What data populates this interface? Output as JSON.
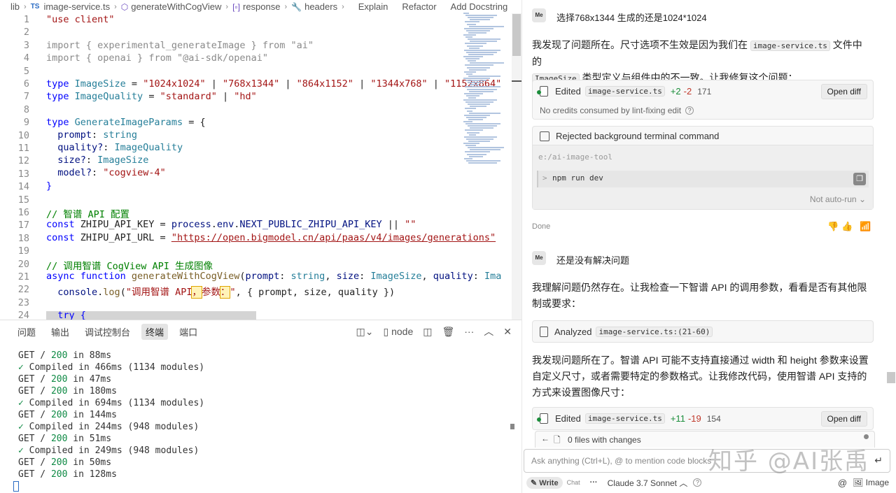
{
  "breadcrumb": {
    "folder": "lib",
    "ts_badge": "TS",
    "file": "image-service.ts",
    "symbol": "generateWithCogView",
    "var": "response",
    "field": "headers",
    "actions": [
      "Explain",
      "Refactor",
      "Add Docstring"
    ]
  },
  "line_numbers": [
    "1",
    "2",
    "3",
    "4",
    "5",
    "6",
    "7",
    "8",
    "9",
    "10",
    "11",
    "12",
    "13",
    "14",
    "15",
    "16",
    "17",
    "18",
    "19",
    "20",
    "21",
    "22",
    "23",
    "24"
  ],
  "code": {
    "l1": "\"use client\"",
    "l3a": "import",
    "l3b": " { experimental_generateImage } ",
    "l3c": "from",
    "l3d": " \"ai\"",
    "l4a": "import",
    "l4b": " { openai } ",
    "l4c": "from",
    "l4d": " \"@ai-sdk/openai\"",
    "l6a": "type",
    "l6b": " ImageSize",
    "l6c": " = ",
    "l6d": "\"1024x1024\"",
    "l6e": " | ",
    "l6f": "\"768x1344\"",
    "l6g": " | ",
    "l6h": "\"864x1152\"",
    "l6i": " | ",
    "l6j": "\"1344x768\"",
    "l6k": " | ",
    "l6l": "\"1152x864\"",
    "l7a": "type",
    "l7b": " ImageQuality",
    "l7c": " = ",
    "l7d": "\"standard\"",
    "l7e": " | ",
    "l7f": "\"hd\"",
    "l9a": "type",
    "l9b": " GenerateImageParams",
    "l9c": " = {",
    "l10a": "  prompt",
    "l10b": ": ",
    "l10c": "string",
    "l11a": "  quality?",
    "l11b": ": ",
    "l11c": "ImageQuality",
    "l12a": "  size?",
    "l12b": ": ",
    "l12c": "ImageSize",
    "l13a": "  model?",
    "l13b": ": ",
    "l13c": "\"cogview-4\"",
    "l14": "}",
    "l16": "// 智谱 API 配置",
    "l17a": "const",
    "l17b": " ZHIPU_API_KEY = ",
    "l17c": "process",
    "l17d": ".",
    "l17e": "env",
    "l17f": ".",
    "l17g": "NEXT_PUBLIC_ZHIPU_API_KEY",
    "l17h": " || ",
    "l17i": "\"\"",
    "l18a": "const",
    "l18b": " ZHIPU_API_URL = ",
    "l18c": "\"https://open.bigmodel.cn/api/paas/v4/images/generations\"",
    "l20": "// 调用智谱 CogView API 生成图像",
    "l21a": "async function",
    "l21b": " generateWithCogView",
    "l21c": "(",
    "l21d": "prompt",
    "l21e": ": ",
    "l21f": "string",
    "l21g": ", ",
    "l21h": "size",
    "l21i": ": ",
    "l21j": "ImageSize",
    "l21k": ", ",
    "l21l": "quality",
    "l21m": ": ",
    "l21n": "Ima",
    "l22a": "  console",
    "l22b": ".",
    "l22c": "log",
    "l22d": "(",
    "l22e": "\"调用智谱 API",
    "l22f": "，",
    "l22g": "参数",
    "l22h": "：",
    "l22i": "\"",
    "l22j": ", { prompt, size, quality })",
    "l24": "  try {"
  },
  "panel_tabs": [
    "问题",
    "输出",
    "调试控制台",
    "终端",
    "端口"
  ],
  "panel_tools": {
    "node": "node"
  },
  "terminal_lines": [
    {
      "a": "GET / ",
      "b": "200",
      "c": " in 88ms",
      "check": ""
    },
    {
      "a": " Compiled in 466ms (1134 modules)",
      "check": "✓"
    },
    {
      "a": "GET / ",
      "b": "200",
      "c": " in 47ms",
      "check": ""
    },
    {
      "a": "GET / ",
      "b": "200",
      "c": " in 180ms",
      "check": ""
    },
    {
      "a": " Compiled in 694ms (1134 modules)",
      "check": "✓"
    },
    {
      "a": "GET / ",
      "b": "200",
      "c": " in 144ms",
      "check": ""
    },
    {
      "a": " Compiled in 244ms (948 modules)",
      "check": "✓"
    },
    {
      "a": "GET / ",
      "b": "200",
      "c": " in 51ms",
      "check": ""
    },
    {
      "a": " Compiled in 249ms (948 modules)",
      "check": "✓"
    },
    {
      "a": "GET / ",
      "b": "200",
      "c": " in 50ms",
      "check": ""
    },
    {
      "a": "GET / ",
      "b": "200",
      "c": " in 128ms",
      "check": ""
    }
  ],
  "chat": {
    "avatar": "Me",
    "user1": "选择768x1344  生成的还是1024*1024",
    "reply1_a": "我发现了问题所在。尺寸选项不生效是因为我们在 ",
    "reply1_code1": "image-service.ts",
    "reply1_b": " 文件中的",
    "reply1_code2": "ImageSize",
    "reply1_c": " 类型定义与组件中的不一致。让我修复这个问题：",
    "edit1": {
      "label": "Edited",
      "file": "image-service.ts",
      "add": "+2",
      "del": "-2",
      "count": "171",
      "btn": "Open diff",
      "note": "No credits consumed by lint-fixing edit"
    },
    "term_card": {
      "title": "Rejected background terminal command",
      "cwd": "e:/ai-image-tool",
      "prompt": ">",
      "cmd": "npm run dev",
      "status": "Not auto-run"
    },
    "done": "Done",
    "user2": "还是没有解决问题",
    "reply2": "我理解问题仍然存在。让我检查一下智谱 API 的调用参数，看看是否有其他限制或要求：",
    "analyzed": {
      "label": "Analyzed",
      "file": "image-service.ts:(21-60)"
    },
    "reply3": "我发现问题所在了。智谱 API 可能不支持直接通过 width 和 height 参数来设置自定义尺寸，或者需要特定的参数格式。让我修改代码，使用智谱 API 支持的方式来设置图像尺寸：",
    "edit2": {
      "label": "Edited",
      "file": "image-service.ts",
      "add": "+11",
      "del": "-19",
      "count": "154",
      "btn": "Open diff"
    },
    "files_changes": "0 files with changes",
    "input_placeholder": "Ask anything (Ctrl+L), @ to mention code blocks",
    "bottom": {
      "write": "Write",
      "chat": "Chat",
      "more": "···",
      "model": "Claude 3.7 Sonnet",
      "image": "Image"
    },
    "watermark": "知乎 @AI张禹"
  }
}
